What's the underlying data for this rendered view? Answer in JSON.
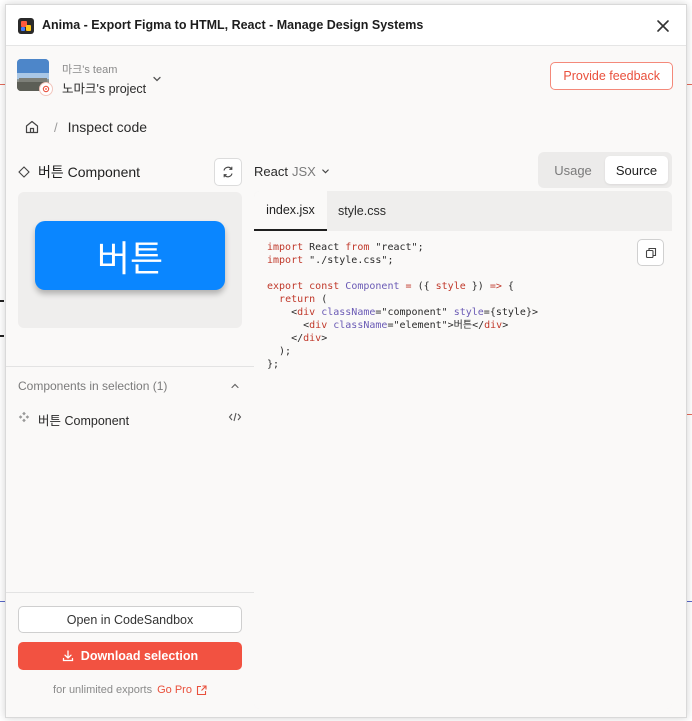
{
  "window": {
    "title": "Anima - Export Figma to HTML, React - Manage Design Systems"
  },
  "header": {
    "team_name": "마크's team",
    "project_name": "노마크's project",
    "feedback_label": "Provide feedback"
  },
  "breadcrumb": {
    "separator": "/",
    "current": "Inspect code"
  },
  "component": {
    "title": "버튼 Component",
    "preview_label": "버튼"
  },
  "components_section": {
    "header": "Components in selection (1)",
    "items": [
      {
        "label": "버튼 Component"
      }
    ]
  },
  "actions": {
    "sandbox_label": "Open in CodeSandbox",
    "download_label": "Download selection",
    "limited_text": "for unlimited exports",
    "go_pro_label": "Go Pro"
  },
  "framework": {
    "main": "React",
    "sub": "JSX"
  },
  "view_toggle": {
    "usage": "Usage",
    "source": "Source",
    "selected": "Source"
  },
  "code_tabs": [
    {
      "label": "index.jsx",
      "active": true
    },
    {
      "label": "style.css",
      "active": false
    }
  ],
  "code": {
    "lines": [
      "import React from \"react\";",
      "import \"./style.css\";",
      "",
      "export const Component = ({ style }) => {",
      "  return (",
      "    <div className=\"component\" style={style}>",
      "      <div className=\"element\">버튼</div>",
      "    </div>",
      "  );",
      "};"
    ]
  },
  "colors": {
    "accent": "#f25241",
    "preview_button": "#0a86ff"
  }
}
